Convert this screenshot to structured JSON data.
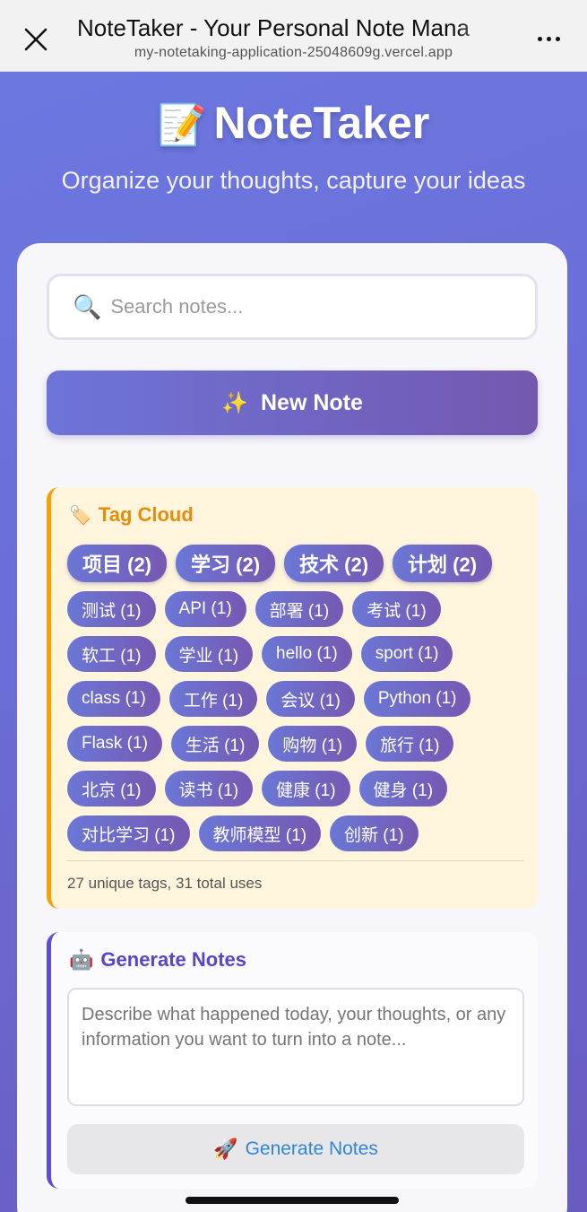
{
  "browser": {
    "title": "NoteTaker - Your Personal Note Mana",
    "url": "my-notetaking-application-25048609g.vercel.app"
  },
  "hero": {
    "emoji": "📝",
    "title": "NoteTaker",
    "subtitle": "Organize your thoughts, capture your ideas"
  },
  "search": {
    "icon": "🔍",
    "placeholder": "Search notes..."
  },
  "new_note": {
    "emoji": "✨",
    "label": "New Note"
  },
  "tag_cloud": {
    "emoji": "🏷️",
    "title": "Tag Cloud",
    "tags": [
      {
        "label": "项目 (2)",
        "big": true
      },
      {
        "label": "学习 (2)",
        "big": true
      },
      {
        "label": "技术 (2)",
        "big": true
      },
      {
        "label": "计划 (2)",
        "big": true
      },
      {
        "label": "测试 (1)"
      },
      {
        "label": "API (1)"
      },
      {
        "label": "部署 (1)"
      },
      {
        "label": "考试 (1)"
      },
      {
        "label": "软工 (1)"
      },
      {
        "label": "学业 (1)"
      },
      {
        "label": "hello (1)"
      },
      {
        "label": "sport (1)"
      },
      {
        "label": "class (1)"
      },
      {
        "label": "工作 (1)"
      },
      {
        "label": "会议 (1)"
      },
      {
        "label": "Python (1)"
      },
      {
        "label": "Flask (1)"
      },
      {
        "label": "生活 (1)"
      },
      {
        "label": "购物 (1)"
      },
      {
        "label": "旅行 (1)"
      },
      {
        "label": "北京 (1)"
      },
      {
        "label": "读书 (1)"
      },
      {
        "label": "健康 (1)"
      },
      {
        "label": "健身 (1)"
      },
      {
        "label": "对比学习 (1)"
      },
      {
        "label": "教师模型 (1)"
      },
      {
        "label": "创新 (1)"
      }
    ],
    "summary": "27 unique tags, 31 total uses"
  },
  "generate": {
    "emoji": "🤖",
    "title": "Generate Notes",
    "placeholder": "Describe what happened today, your thoughts, or any information you want to turn into a note...",
    "button_emoji": "🚀",
    "button_label": "Generate Notes"
  },
  "colors": {
    "accent": "#6d74d8",
    "tag_cloud_title": "#e78c0a",
    "generate_title": "#5547c7",
    "generate_button_text": "#2f86d6"
  }
}
